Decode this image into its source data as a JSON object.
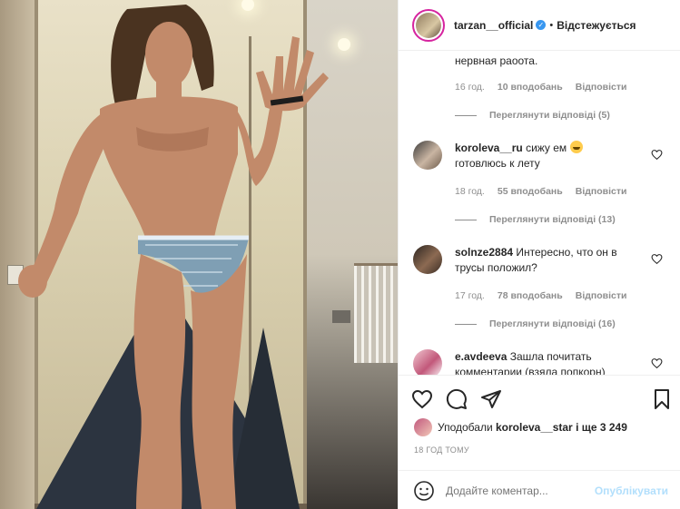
{
  "post": {
    "author": "tarzan__official",
    "verified_glyph": "✓",
    "separator": "•",
    "follow_status": "Відстежується"
  },
  "comments": [
    {
      "id": "c0",
      "user": "",
      "text": "нервная раoота.",
      "time": "16 год.",
      "likes": "10 вподобань",
      "reply": "Відповісти",
      "view_replies": "Переглянути відповіді (5)"
    },
    {
      "id": "c1",
      "user": "koroleva__ru",
      "text": "сижу ем",
      "text2": "готовлюсь к лету",
      "time": "18 год.",
      "likes": "55 вподобань",
      "reply": "Відповісти",
      "view_replies": "Переглянути відповіді (13)"
    },
    {
      "id": "c2",
      "user": "solnze2884",
      "text": "Интересно, что он в",
      "text2": "трусы положил?",
      "time": "17 год.",
      "likes": "78 вподобань",
      "reply": "Відповісти",
      "view_replies": "Переглянути відповіді (16)"
    },
    {
      "id": "c3",
      "user": "e.avdeeva",
      "text": "Зашла почитать",
      "text2": "комментарии (взяла попкорн)"
    }
  ],
  "likes_line": {
    "prefix": "Уподобали",
    "user": "koroleva__star",
    "suffix": "і ще 3 249"
  },
  "timestamp": "18 ГОД ТОМУ",
  "comment_box": {
    "placeholder": "Додайте коментар...",
    "post_label": "Опублікувати"
  },
  "colors": {
    "verified": "#3897f0",
    "story_ring": "#d6249f",
    "post_disabled": "#b2dffc",
    "secondary_text": "#8e8e8e"
  },
  "icons": [
    "heart-icon",
    "comment-icon",
    "share-icon",
    "bookmark-icon",
    "emoji-icon"
  ]
}
